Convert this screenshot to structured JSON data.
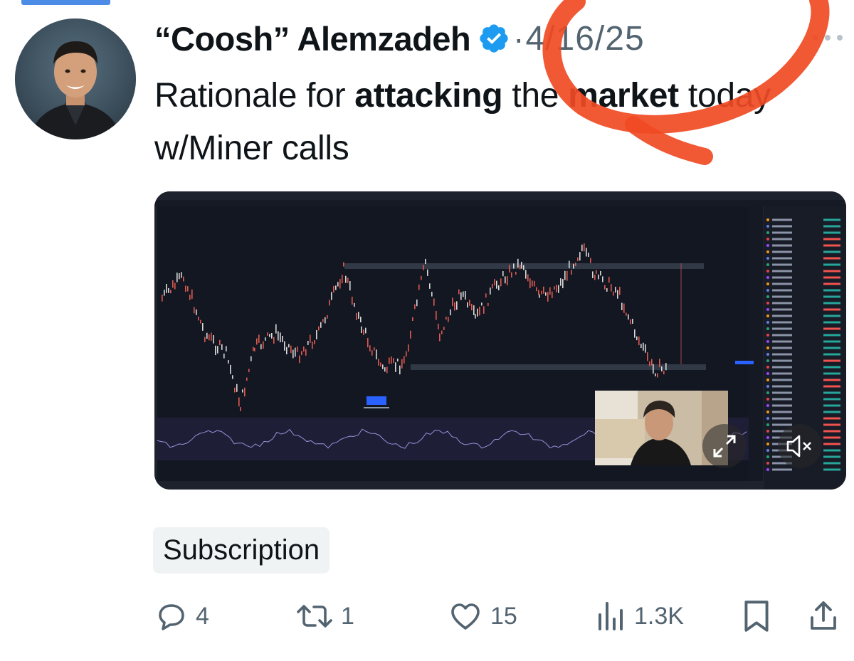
{
  "tweet": {
    "author_name": "“Coosh” Alemzadeh",
    "separator": "·",
    "date": "4/16/25",
    "text_parts": [
      "Rationale for ",
      "attacking",
      " the ",
      "market",
      " today w/Miner calls"
    ],
    "tag": "Subscription"
  },
  "actions": {
    "replies": "4",
    "reposts": "1",
    "likes": "15",
    "views": "1.3K"
  },
  "icons": {
    "verified": "verified-badge-icon",
    "more": "more-icon",
    "reply": "reply-icon",
    "repost": "repost-icon",
    "like": "heart-icon",
    "views": "views-icon",
    "bookmark": "bookmark-icon",
    "share": "share-icon",
    "expand": "expand-icon",
    "mute": "mute-icon"
  },
  "colors": {
    "verified_blue": "#1d9bf0",
    "muted_text": "#536471",
    "annotation_red": "#f04a23",
    "chart_bg": "#131722"
  }
}
